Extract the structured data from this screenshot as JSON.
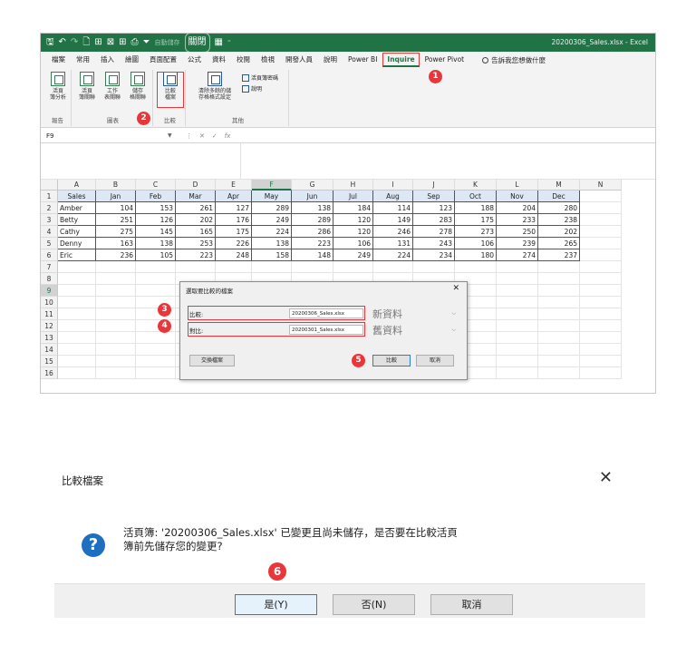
{
  "window": {
    "qat_icons": [
      "save-icon",
      "undo-icon",
      "redo-icon",
      "new-icon",
      "table-icon",
      "pivot-icon",
      "grid-icon",
      "print-icon",
      "filter-icon"
    ],
    "autosave_label": "自動儲存",
    "autosave_state": "關閉",
    "title": "20200306_Sales.xlsx  -  Excel"
  },
  "tabs": [
    "檔案",
    "常用",
    "插入",
    "繪圖",
    "頁面配置",
    "公式",
    "資料",
    "校閱",
    "檢視",
    "開發人員",
    "說明",
    "Power BI",
    "Inquire",
    "Power Pivot"
  ],
  "active_tab": "Inquire",
  "tell_me": "告訴我您想做什麼",
  "ribbon": {
    "groups": {
      "report": "報告",
      "diagram": "圖表",
      "compare": "比較",
      "misc": "其他"
    },
    "buttons": {
      "workbook_analysis": [
        "活頁",
        "簿分析"
      ],
      "cell_relationship": [
        "儲存",
        "格關聯"
      ],
      "workbook_relationship": [
        "活頁",
        "簿關聯"
      ],
      "worksheet_relationship": [
        "工作",
        "表關聯"
      ],
      "compare_files": [
        "比較",
        "檔案"
      ],
      "clean_formatting": [
        "清除多餘的儲",
        "存格格式設定"
      ],
      "workbook_passwords": "活頁簿密碼",
      "help": "說明"
    }
  },
  "formula_bar": {
    "name_box": "F9",
    "fx": "fx"
  },
  "sheet": {
    "columns": [
      "A",
      "B",
      "C",
      "D",
      "E",
      "F",
      "G",
      "H",
      "I",
      "J",
      "K",
      "L",
      "M",
      "N"
    ],
    "selected_column": "F",
    "rows": [
      "1",
      "2",
      "3",
      "4",
      "5",
      "6",
      "7",
      "8",
      "9",
      "10",
      "11",
      "12",
      "13",
      "14",
      "15",
      "16"
    ],
    "selected_row": "9",
    "header": [
      "Sales",
      "Jan",
      "Feb",
      "Mar",
      "Apr",
      "May",
      "Jun",
      "Jul",
      "Aug",
      "Sep",
      "Oct",
      "Nov",
      "Dec"
    ],
    "data": [
      [
        "Amber",
        "104",
        "153",
        "261",
        "127",
        "289",
        "138",
        "184",
        "114",
        "123",
        "188",
        "204",
        "280"
      ],
      [
        "Betty",
        "251",
        "126",
        "202",
        "176",
        "249",
        "289",
        "120",
        "149",
        "283",
        "175",
        "233",
        "238"
      ],
      [
        "Cathy",
        "275",
        "145",
        "165",
        "175",
        "224",
        "286",
        "120",
        "246",
        "278",
        "273",
        "250",
        "202"
      ],
      [
        "Denny",
        "163",
        "138",
        "253",
        "226",
        "138",
        "223",
        "106",
        "131",
        "243",
        "106",
        "239",
        "265"
      ],
      [
        "Eric",
        "236",
        "105",
        "223",
        "248",
        "158",
        "148",
        "249",
        "224",
        "234",
        "180",
        "274",
        "237"
      ]
    ]
  },
  "pick_dialog": {
    "title": "選取要比較的檔案",
    "compare_label": "比較:",
    "compare_file": "20200306_Sales.xlsx",
    "compare_note": "新資料",
    "to_label": "對比:",
    "to_file": "20200301_Sales.xlsx",
    "to_note": "舊資料",
    "swap_button": "交換檔案",
    "compare_button": "比較",
    "cancel_button": "取消"
  },
  "confirm_dialog": {
    "title": "比較檔案",
    "message_line1": "活頁簿: '20200306_Sales.xlsx' 已變更且尚未儲存，是否要在比較活頁",
    "message_line2": "簿前先儲存您的變更?",
    "yes_button": "是(Y)",
    "no_button": "否(N)",
    "cancel_button": "取消"
  },
  "steps": [
    "1",
    "2",
    "3",
    "4",
    "5",
    "6"
  ],
  "colors": {
    "excel_green": "#217346",
    "highlight_red": "#e8363b",
    "button_blue": "#2a7ad8"
  }
}
